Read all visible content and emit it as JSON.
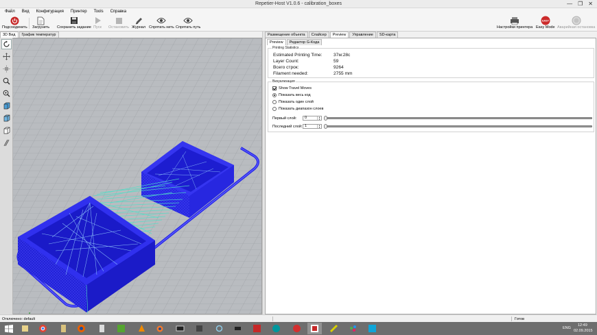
{
  "window": {
    "title": "Repetier-Host V1.0.6 - calibration_boxes",
    "minimize": "—",
    "maximize": "❐",
    "close": "✕"
  },
  "menu": [
    "Файл",
    "Вид",
    "Конфигурация",
    "Принтер",
    "Tools",
    "Справка"
  ],
  "toolbar": {
    "connect": "Подсоединить",
    "load": "Загрузить",
    "save_job": "Сохранить задание",
    "run": "Пуск",
    "stop": "Остановить",
    "log": "Журнал",
    "hide_filament": "Спрятать нить",
    "hide_path": "Спрятать путь",
    "printer_settings": "Настройки принтера",
    "easy_mode": "Easy Mode",
    "easy_badge": "EASY",
    "emergency_stop": "Аварийная остановка",
    "accent_red": "#cc2b2b"
  },
  "left_tabs": [
    "3D Вид",
    "График температур"
  ],
  "right_tabs": [
    "Размещение объекта",
    "Слайсер",
    "Preview",
    "Управление",
    "SD-карта"
  ],
  "preview_subtabs": [
    "Preview",
    "Редактор G-Кода"
  ],
  "printing_statistics": {
    "label": "Printing Statistics",
    "rows": [
      {
        "name": "Estimated Printing Time:",
        "value": "37м:28с"
      },
      {
        "name": "Layer Count:",
        "value": "59"
      },
      {
        "name": "Всего строк:",
        "value": "9264"
      },
      {
        "name": "Filament needed:",
        "value": "2755 mm"
      }
    ]
  },
  "visualization": {
    "label": "Визуализация",
    "show_travel": "Show Travel Moves",
    "show_all": "Показать весь код",
    "show_one_layer": "Показать один слой",
    "show_range": "Показать диапазон слоев",
    "first_layer_label": "Первый слой:",
    "first_layer_value": "0",
    "last_layer_label": "Последний слой:",
    "last_layer_value": "1"
  },
  "status": {
    "connection": "Отключено: default",
    "state": "Готов"
  },
  "taskbar": {
    "lang": "ENG",
    "time": "12:49",
    "date": "02.09.2015"
  },
  "colors": {
    "model_blue": "#2a2ae8",
    "travel_cyan": "#4fe0c8",
    "viewport_bg": "#b9bcc0"
  }
}
